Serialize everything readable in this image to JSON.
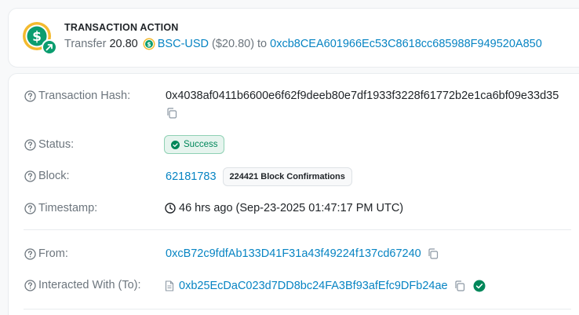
{
  "action": {
    "title": "TRANSACTION ACTION",
    "verb": "Transfer",
    "amount": "20.80",
    "token": "BSC-USD",
    "usd_value": "($20.80)",
    "to_word": "to",
    "to_address": "0xcb8CEA601966Ec53C8618cc685988F949520A850"
  },
  "details": {
    "hash": {
      "label": "Transaction Hash:",
      "value": "0x4038af0411b6600e6f62f9deeb80e7df1933f3228f61772b2e1ca6bf09e33d35"
    },
    "status": {
      "label": "Status:",
      "value": "Success"
    },
    "block": {
      "label": "Block:",
      "number": "62181783",
      "confirmations": "224421 Block Confirmations"
    },
    "timestamp": {
      "label": "Timestamp:",
      "value": "46 hrs ago (Sep-23-2025 01:47:17 PM UTC)"
    },
    "from": {
      "label": "From:",
      "address": "0xcB72c9fdfAb133D41F31a43f49224f137cd67240"
    },
    "to": {
      "label": "Interacted With (To):",
      "address": "0xb25EcDaC023d7DD8bc24FA3Bf93afEfc9DFb24ae"
    }
  },
  "colors": {
    "link": "#0784c3",
    "success": "#00875a",
    "coin_green": "#0a9d6f",
    "coin_ring": "#f3ba2f"
  }
}
